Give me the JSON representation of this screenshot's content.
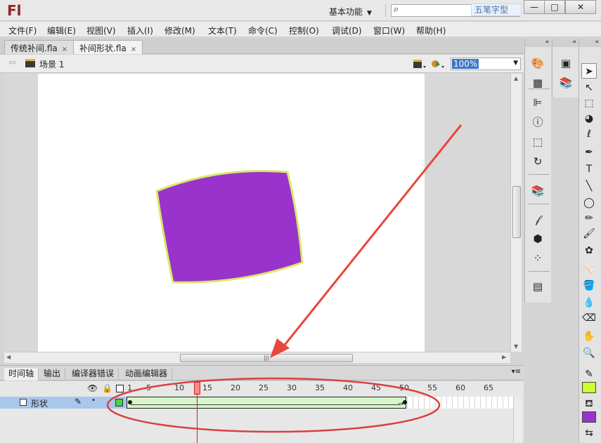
{
  "app": {
    "logo": "Fl",
    "workspace_label": "基本功能",
    "watermark_text": "五笔字型",
    "window_buttons": {
      "minimize": "—",
      "maximize": "□",
      "close": "✕"
    }
  },
  "menu": [
    "文件(F)",
    "编辑(E)",
    "视图(V)",
    "插入(I)",
    "修改(M)",
    "文本(T)",
    "命令(C)",
    "控制(O)",
    "调试(D)",
    "窗口(W)",
    "帮助(H)"
  ],
  "doc_tabs": [
    {
      "label": "传统补间.fla",
      "active": false
    },
    {
      "label": "补间形状.fla",
      "active": true
    }
  ],
  "edit_bar": {
    "scene_label": "场景 1",
    "zoom": "100%"
  },
  "stage": {
    "background": "#ffffff",
    "shape_fill": "#9933cc",
    "shape_stroke": "#d8e86a"
  },
  "timeline": {
    "tabs": [
      "时间轴",
      "输出",
      "编译器错误",
      "动画编辑器"
    ],
    "ruler_labels": [
      "1",
      "5",
      "10",
      "15",
      "20",
      "25",
      "30",
      "35",
      "40",
      "45",
      "50",
      "55",
      "60",
      "65"
    ],
    "layer_name": "形状",
    "layer_color": "#4bd04b",
    "tween_color": "#d6f5c8",
    "current_frame": 14,
    "tween_start_frame": 1,
    "tween_end_frame": 50
  },
  "annotations": {
    "arrow_color": "#e8473b",
    "ellipse_color": "#d94040"
  },
  "tools": {
    "stroke_color": "#ccff33",
    "fill_color": "#9933cc"
  }
}
